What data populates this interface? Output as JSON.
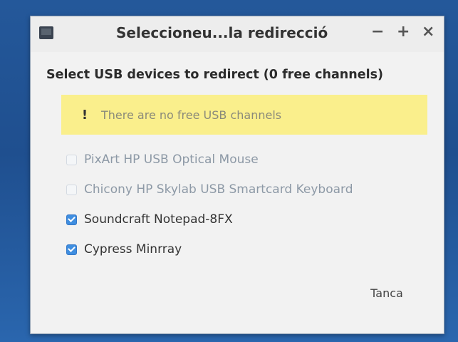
{
  "window": {
    "title": "Seleccioneu...la redirecció",
    "controls": {
      "minimize": "−",
      "maximize": "+",
      "close": "×"
    }
  },
  "dialog": {
    "heading": "Select USB devices to redirect (0 free channels)",
    "warning": {
      "icon": "!",
      "text": "There are no free USB channels"
    },
    "devices": [
      {
        "label": "PixArt HP USB Optical Mouse",
        "checked": false,
        "enabled": false
      },
      {
        "label": "Chicony HP Skylab USB Smartcard Keyboard",
        "checked": false,
        "enabled": false
      },
      {
        "label": "Soundcraft Notepad-8FX",
        "checked": true,
        "enabled": true
      },
      {
        "label": "Cypress Minrray",
        "checked": true,
        "enabled": true
      }
    ],
    "close_label": "Tanca"
  },
  "colors": {
    "desktop": "#24589a",
    "warning_bg": "#faef8c",
    "checkbox_accent": "#3f8ee0"
  }
}
